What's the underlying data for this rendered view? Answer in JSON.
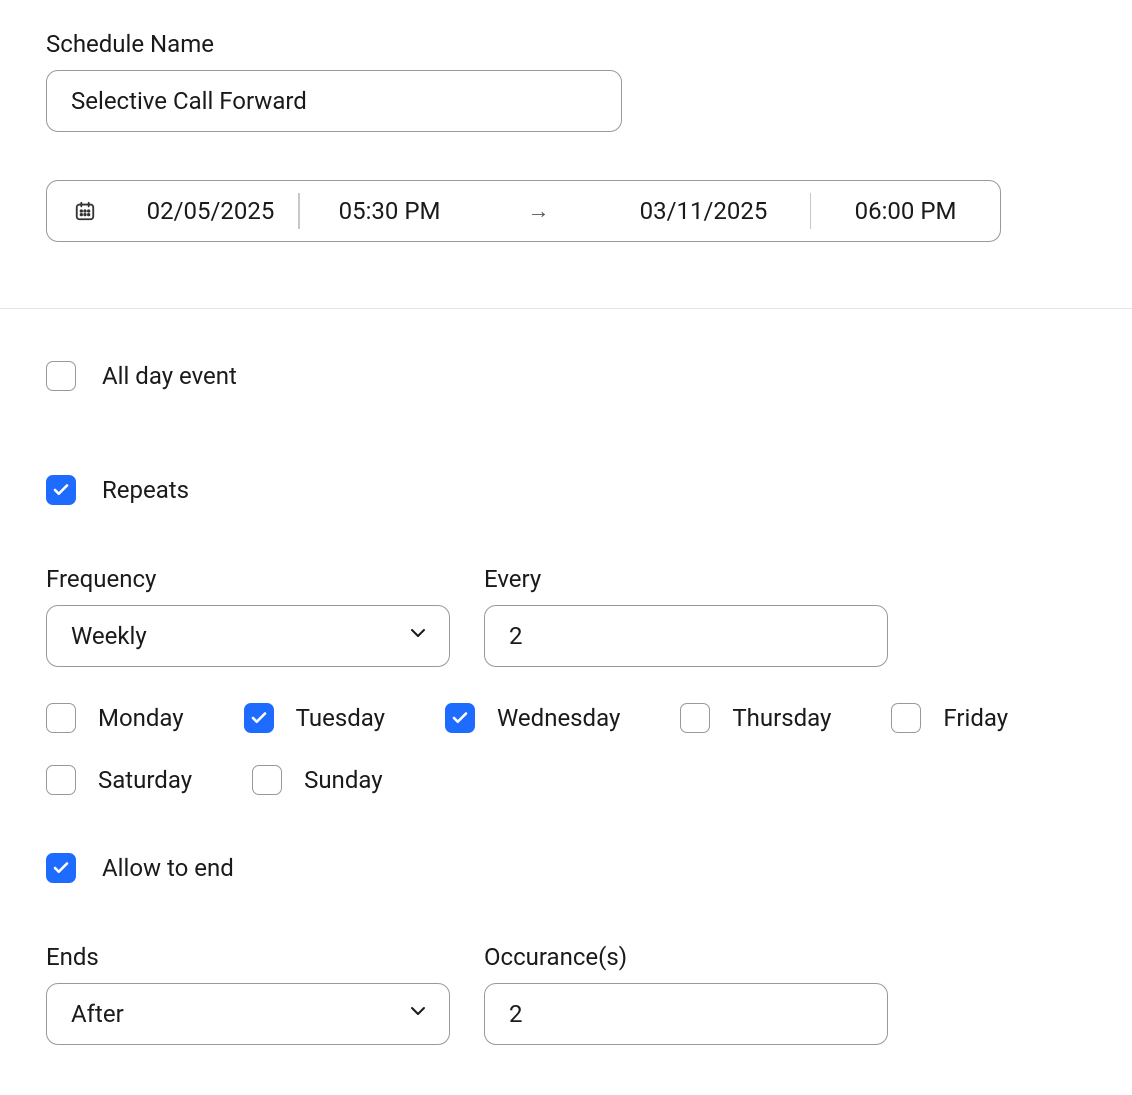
{
  "schedule": {
    "name_label": "Schedule Name",
    "name_value": "Selective Call Forward"
  },
  "datetime": {
    "start_date": "02/05/2025",
    "start_time": "05:30 PM",
    "end_date": "03/11/2025",
    "end_time": "06:00 PM",
    "arrow": "→"
  },
  "all_day": {
    "label": "All day event",
    "checked": false
  },
  "repeats": {
    "label": "Repeats",
    "checked": true
  },
  "frequency": {
    "label": "Frequency",
    "value": "Weekly"
  },
  "every": {
    "label": "Every",
    "value": "2"
  },
  "days": {
    "monday": {
      "label": "Monday",
      "checked": false
    },
    "tuesday": {
      "label": "Tuesday",
      "checked": true
    },
    "wednesday": {
      "label": "Wednesday",
      "checked": true
    },
    "thursday": {
      "label": "Thursday",
      "checked": false
    },
    "friday": {
      "label": "Friday",
      "checked": false
    },
    "saturday": {
      "label": "Saturday",
      "checked": false
    },
    "sunday": {
      "label": "Sunday",
      "checked": false
    }
  },
  "allow_end": {
    "label": "Allow to end",
    "checked": true
  },
  "ends": {
    "label": "Ends",
    "value": "After"
  },
  "occurrence": {
    "label": "Occurance(s)",
    "value": "2"
  }
}
